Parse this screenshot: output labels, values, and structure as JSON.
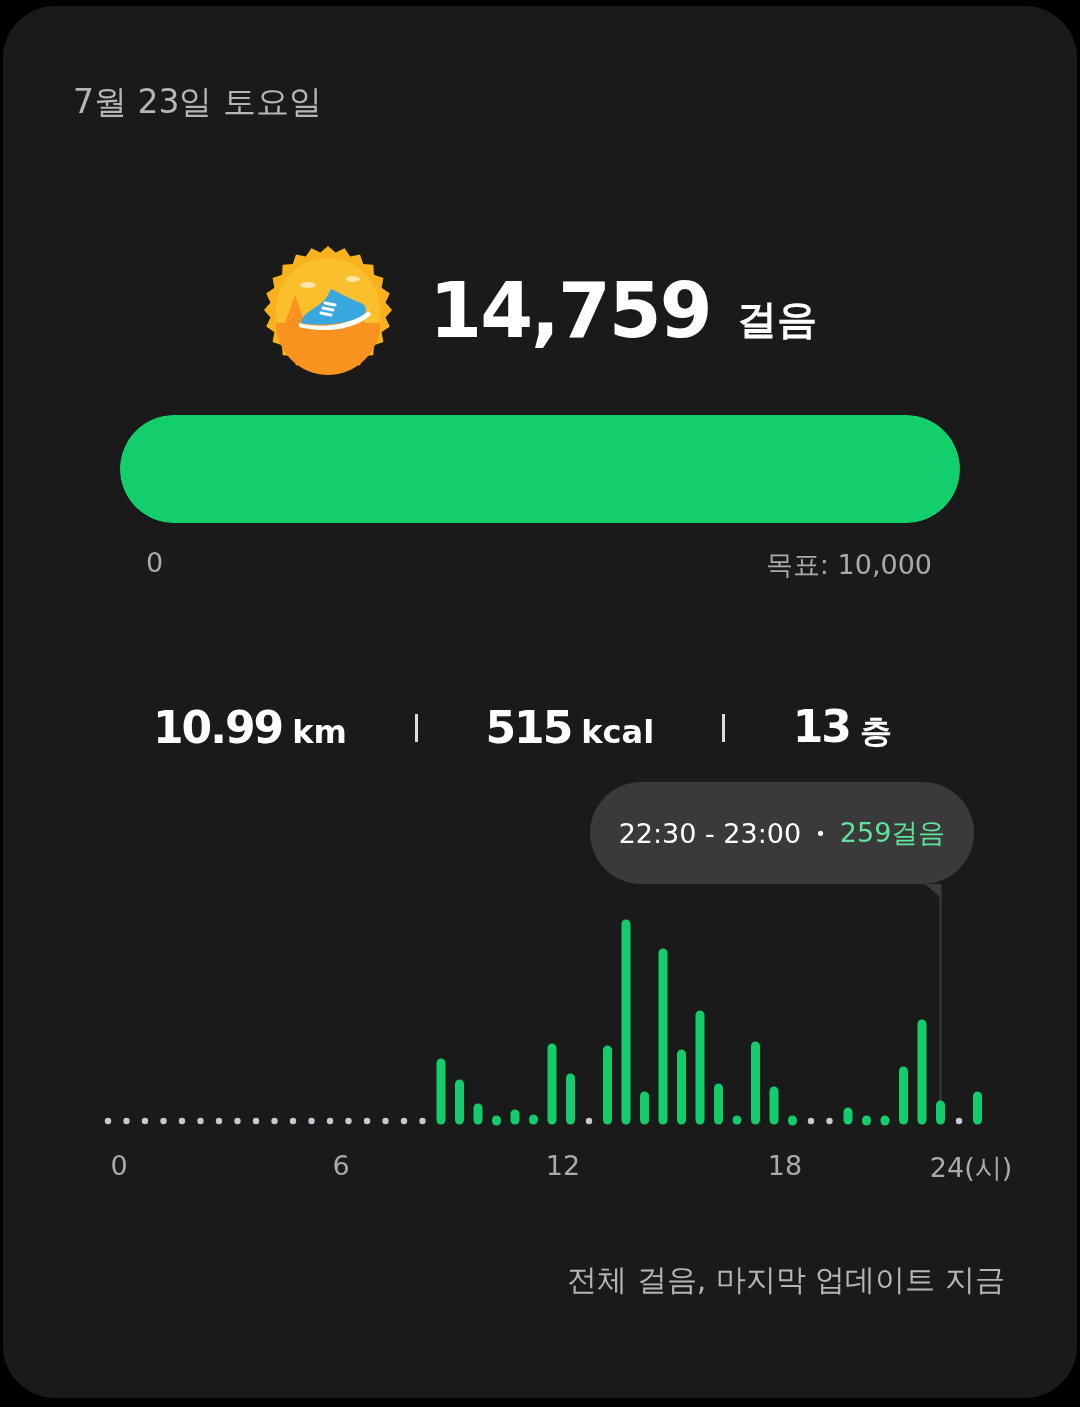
{
  "date": "7월 23일 토요일",
  "steps": {
    "count": "14,759",
    "unit": "걸음"
  },
  "goal": {
    "level": 1,
    "start": "0",
    "target": "목표: 10,000"
  },
  "stats": [
    {
      "value": "10.99",
      "unit": "km"
    },
    {
      "value": "515",
      "unit": "kcal"
    },
    {
      "value": "13",
      "unit": "층"
    }
  ],
  "chart": {
    "tooltip": {
      "time": "22:30 - 23:00",
      "separator": "•",
      "steps": "259걸음"
    },
    "xticks": [
      "0",
      "6",
      "12",
      "18",
      "24(시)"
    ]
  },
  "footer": "전체 걸음, 마지막 업데이트 지금"
}
